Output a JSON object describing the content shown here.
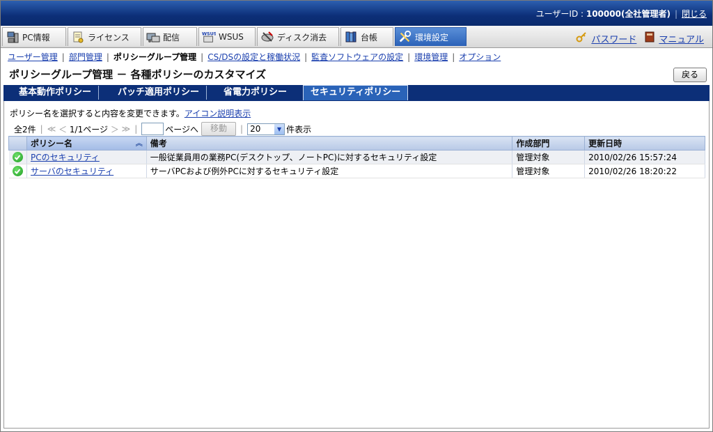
{
  "header": {
    "user_label": "ユーザーID : ",
    "user_id": "100000(全社管理者)",
    "close_link": "閉じる"
  },
  "main_tabs": [
    {
      "label": "PC情報",
      "icon": "pc-icon"
    },
    {
      "label": "ライセンス",
      "icon": "license-icon"
    },
    {
      "label": "配信",
      "icon": "distribution-icon"
    },
    {
      "label": "WSUS",
      "icon": "wsus-icon"
    },
    {
      "label": "ディスク消去",
      "icon": "disk-erase-icon"
    },
    {
      "label": "台帳",
      "icon": "ledger-icon"
    },
    {
      "label": "環境設定",
      "icon": "settings-icon",
      "active": true
    }
  ],
  "right_links": {
    "password": "パスワード",
    "manual": "マニュアル"
  },
  "sub_nav": [
    {
      "label": "ユーザー管理",
      "current": false
    },
    {
      "label": "部門管理",
      "current": false
    },
    {
      "label": "ポリシーグループ管理",
      "current": true
    },
    {
      "label": "CS/DSの設定と稼働状況",
      "current": false
    },
    {
      "label": "監査ソフトウェアの設定",
      "current": false
    },
    {
      "label": "環境管理",
      "current": false
    },
    {
      "label": "オプション",
      "current": false
    }
  ],
  "page": {
    "title": "ポリシーグループ管理 － 各種ポリシーのカスタマイズ",
    "back_button": "戻る"
  },
  "policy_tabs": [
    {
      "label": "基本動作ポリシー",
      "active": false
    },
    {
      "label": "パッチ適用ポリシー",
      "active": false
    },
    {
      "label": "省電力ポリシー",
      "active": false
    },
    {
      "label": "セキュリティポリシー",
      "active": true
    }
  ],
  "hint": {
    "text": "ポリシー名を選択すると内容を変更できます。",
    "link": "アイコン説明表示"
  },
  "pager": {
    "total": "全2件",
    "first": "≪",
    "prev": "＜",
    "page_info": "1/1ページ",
    "next": "＞",
    "last": "≫",
    "page_input": "",
    "goto_label": "ページへ",
    "move_button": "移動",
    "per_page": "20",
    "per_page_suffix": "件表示"
  },
  "table": {
    "columns": [
      "ポリシー名",
      "備考",
      "作成部門",
      "更新日時"
    ],
    "rows": [
      {
        "name": "PCのセキュリティ",
        "note": "一般従業員用の業務PC(デスクトップ、ノートPC)に対するセキュリティ設定",
        "dept": "管理対象",
        "updated": "2010/02/26 15:57:24",
        "status_icon": "check-icon"
      },
      {
        "name": "サーバのセキュリティ",
        "note": "サーバPCおよび例外PCに対するセキュリティ設定",
        "dept": "管理対象",
        "updated": "2010/02/26 18:20:22",
        "status_icon": "check-icon"
      }
    ]
  }
}
